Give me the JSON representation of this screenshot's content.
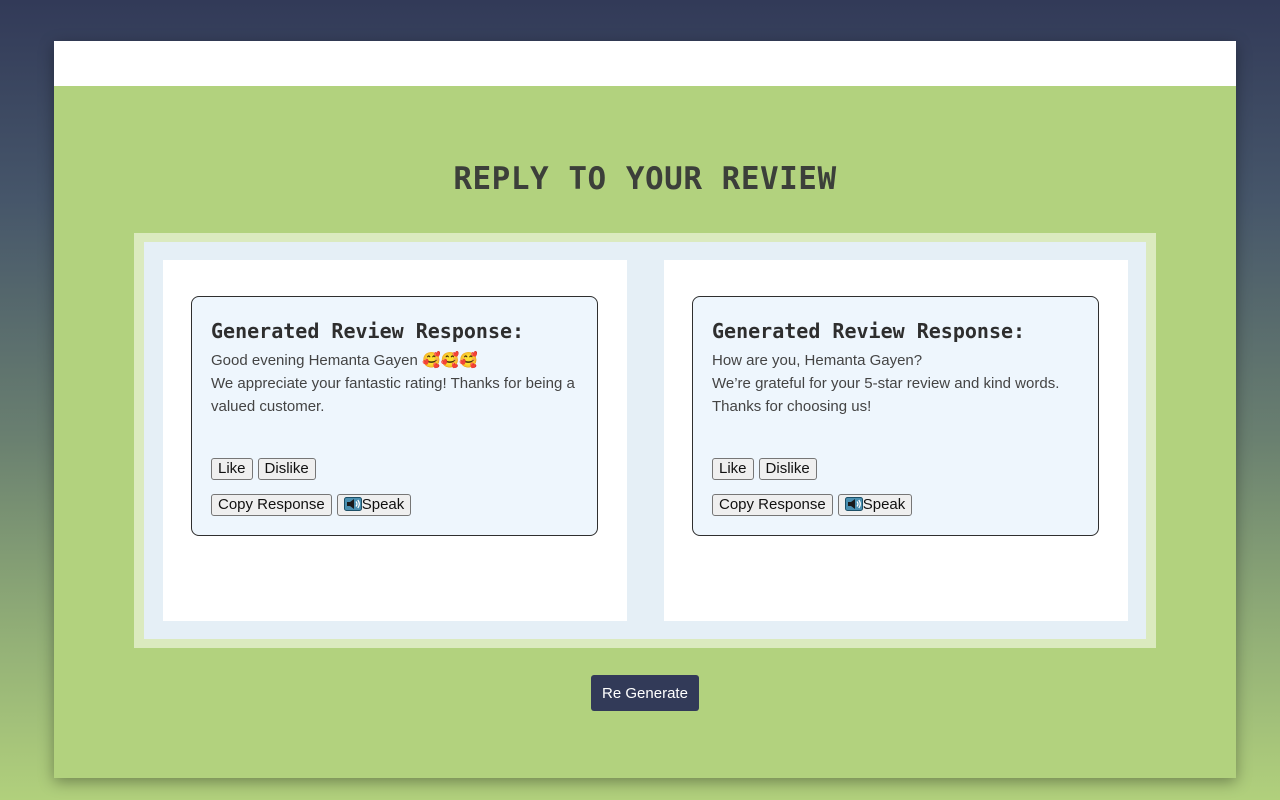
{
  "page": {
    "title": "REPLY TO YOUR REVIEW",
    "regenerate_label": "Re Generate"
  },
  "cards": [
    {
      "heading": "Generated Review Response:",
      "line1": "Good evening Hemanta Gayen",
      "emoji": "🥰🥰🥰",
      "line2": "We appreciate your fantastic rating! Thanks for being a valued customer.",
      "like_label": "Like",
      "dislike_label": "Dislike",
      "copy_label": "Copy Response",
      "speak_label": "Speak"
    },
    {
      "heading": "Generated Review Response:",
      "line1": "How are you, Hemanta Gayen?",
      "line2": "We’re grateful for your 5-star review and kind words. Thanks for choosing us!",
      "like_label": "Like",
      "dislike_label": "Dislike",
      "copy_label": "Copy Response",
      "speak_label": "Speak"
    }
  ],
  "colors": {
    "background_top": "#323a58",
    "panel_green": "#b2d27e",
    "card_bg": "#eef6fd",
    "button_dark": "#323a58"
  }
}
